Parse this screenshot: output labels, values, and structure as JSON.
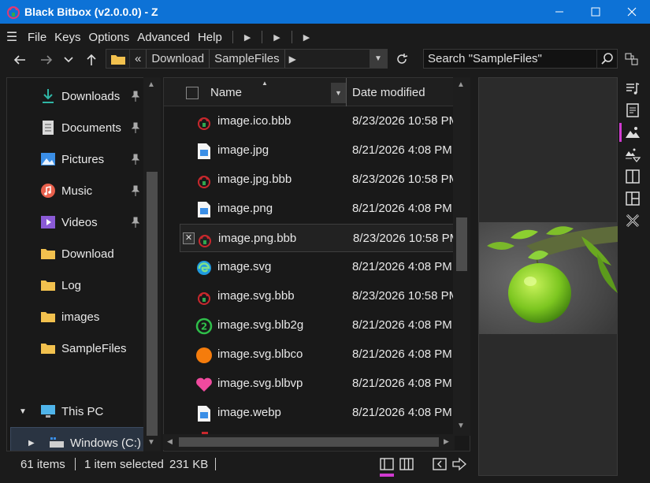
{
  "window": {
    "title": "Black Bitbox (v2.0.0.0) - Z"
  },
  "menu": {
    "items": [
      "File",
      "Keys",
      "Options",
      "Advanced",
      "Help"
    ]
  },
  "address": {
    "crumbs": [
      "Download",
      "SampleFiles"
    ],
    "overflow": "«"
  },
  "search": {
    "placeholder": "Search \"SampleFiles\""
  },
  "nav": {
    "items": [
      {
        "label": "Downloads",
        "icon": "download-arrow-icon",
        "pinned": true
      },
      {
        "label": "Documents",
        "icon": "documents-icon",
        "pinned": true
      },
      {
        "label": "Pictures",
        "icon": "pictures-icon",
        "pinned": true
      },
      {
        "label": "Music",
        "icon": "music-icon",
        "pinned": true
      },
      {
        "label": "Videos",
        "icon": "videos-icon",
        "pinned": true
      },
      {
        "label": "Download",
        "icon": "folder-icon",
        "pinned": false
      },
      {
        "label": "Log",
        "icon": "folder-icon",
        "pinned": false
      },
      {
        "label": "images",
        "icon": "folder-icon",
        "pinned": false
      },
      {
        "label": "SampleFiles",
        "icon": "folder-icon",
        "pinned": false
      }
    ],
    "this_pc": "This PC",
    "drive": "Windows (C:)"
  },
  "files": {
    "col_name": "Name",
    "col_date": "Date modified",
    "rows": [
      {
        "name": "image.ico.bbb",
        "date": "8/23/2026 10:58 PM",
        "icon": "bitbox-lock-icon"
      },
      {
        "name": "image.jpg",
        "date": "8/21/2026 4:08 PM",
        "icon": "image-file-icon"
      },
      {
        "name": "image.jpg.bbb",
        "date": "8/23/2026 10:58 PM",
        "icon": "bitbox-lock-icon"
      },
      {
        "name": "image.png",
        "date": "8/21/2026 4:08 PM",
        "icon": "image-file-icon"
      },
      {
        "name": "image.png.bbb",
        "date": "8/23/2026 10:58 PM",
        "icon": "bitbox-lock-icon"
      },
      {
        "name": "image.svg",
        "date": "8/21/2026 4:08 PM",
        "icon": "edge-browser-icon"
      },
      {
        "name": "image.svg.bbb",
        "date": "8/23/2026 10:58 PM",
        "icon": "bitbox-lock-icon"
      },
      {
        "name": "image.svg.blb2g",
        "date": "8/21/2026 4:08 PM",
        "icon": "green-circle-2-icon"
      },
      {
        "name": "image.svg.blbco",
        "date": "8/21/2026 4:08 PM",
        "icon": "orange-circle-icon"
      },
      {
        "name": "image.svg.blbvp",
        "date": "8/21/2026 4:08 PM",
        "icon": "pink-heart-icon"
      },
      {
        "name": "image.webp",
        "date": "8/21/2026 4:08 PM",
        "icon": "image-file-icon"
      }
    ],
    "selected_index": 4
  },
  "status": {
    "items": "61 items",
    "selected": "1 item selected",
    "size": "231 KB"
  },
  "colors": {
    "titlebar": "#0d72d6",
    "accent_pink": "#d03ad0",
    "bitbox_red": "#c8282d",
    "bitbox_green": "#2fa84f"
  }
}
